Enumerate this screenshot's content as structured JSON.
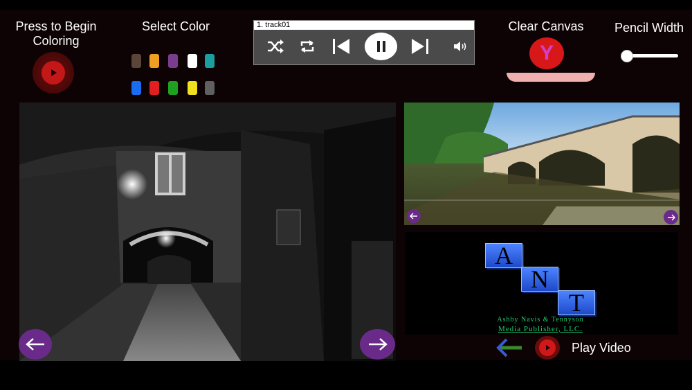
{
  "start": {
    "label_line1": "Press to Begin",
    "label_line2": "Coloring"
  },
  "palette": {
    "label": "Select Color",
    "colors": [
      "#5a4638",
      "#f0a020",
      "#7a3c8c",
      "#ffffff",
      "#1a9ea0",
      "#1a6cf0",
      "#e02020",
      "#20a020",
      "#f0e020",
      "#606060"
    ]
  },
  "player": {
    "track": "1.  track01"
  },
  "clear": {
    "label": "Clear Canvas",
    "button_letter": "Y"
  },
  "pencil": {
    "label": "Pencil Width",
    "value": 0.05
  },
  "logo": {
    "letters": [
      "A",
      "N",
      "T"
    ],
    "line1": "Ashby  Navis  &  Tennyson",
    "line2": "Media Publisher,  LLC."
  },
  "video": {
    "label": "Play Video"
  },
  "colors": {
    "accent_red": "#b01818",
    "nav_purple": "#6a2a8a",
    "logo_green": "#20d070"
  }
}
